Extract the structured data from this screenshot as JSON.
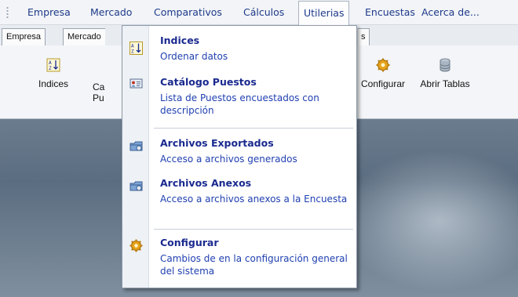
{
  "menubar": {
    "items": [
      "Empresa",
      "Mercado",
      "Comparativos",
      "Cálculos",
      "Utilerias",
      "Encuestas",
      "Acerca de..."
    ]
  },
  "tabs": {
    "items": [
      "Empresa",
      "Mercado"
    ],
    "partial_right": "s"
  },
  "ribbon": {
    "indices_label": "Indices",
    "catalogo_label_line1": "Ca",
    "catalogo_label_line2": "Pu",
    "configurar_label": "Configurar",
    "abrir_tablas_label": "Abrir Tablas"
  },
  "dropdown": {
    "items": [
      {
        "title": "Indices",
        "desc": "Ordenar datos",
        "icon": "sort-az-icon"
      },
      {
        "title": "Catálogo Puestos",
        "desc": "Lista de Puestos encuestados con descripción",
        "icon": "catalog-icon"
      },
      {
        "title": "Archivos Exportados",
        "desc": "Acceso a archivos generados",
        "icon": "export-files-icon"
      },
      {
        "title": "Archivos Anexos",
        "desc": "Acceso a archivos anexos a la Encuesta",
        "icon": "attached-files-icon"
      },
      {
        "title": "Configurar",
        "desc": "Cambios de en la configuración general del sistema",
        "icon": "gear-icon"
      }
    ]
  },
  "colors": {
    "menu_text": "#1e3a8a",
    "dropdown_title": "#1a2a8f",
    "dropdown_desc": "#1f3fb0",
    "desktop_bg": "#5d6f82"
  }
}
